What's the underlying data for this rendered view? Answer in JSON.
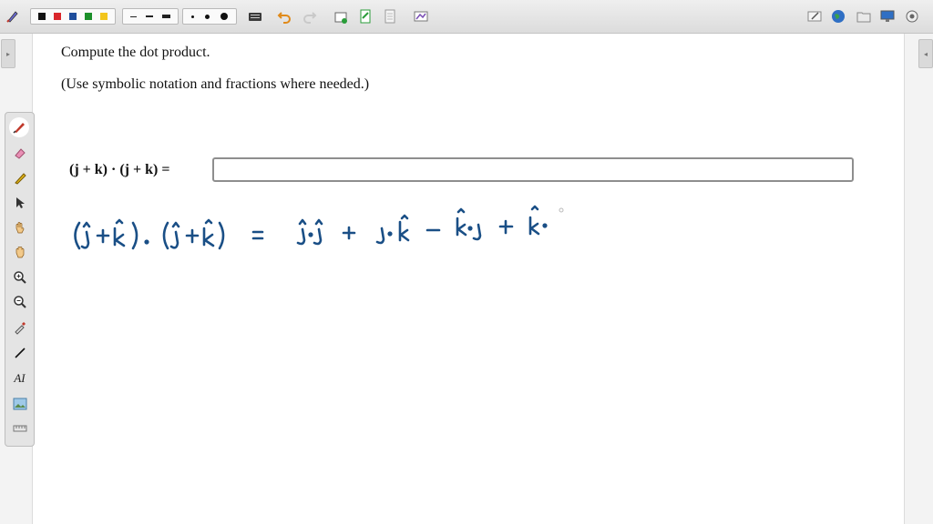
{
  "toolbar": {
    "left_tool": "pen-tool-icon",
    "colors": [
      "#111111",
      "#d9262b",
      "#1f4e9c",
      "#1c8f2a",
      "#f2c51c"
    ],
    "line_styles": [
      "thin-dash",
      "medium-dash",
      "thick-dash"
    ],
    "dot_sizes": [
      "small",
      "medium",
      "large"
    ],
    "actions": [
      "keyboard-icon",
      "undo-icon",
      "redo-icon",
      "new-page-icon",
      "add-page-icon",
      "page-icon",
      "screen-capture-icon"
    ],
    "right_actions": [
      "edit-icon",
      "globe-icon",
      "folder-icon",
      "display-icon",
      "settings-icon"
    ]
  },
  "problem": {
    "prompt": "Compute the dot product.",
    "instruction": "(Use symbolic notation and fractions where needed.)",
    "expression": "(j + k) · (j + k) =",
    "answer_value": ""
  },
  "handwriting": {
    "lhs": "(ĵ+k̂).(ĵ+k̂)",
    "equals": "=",
    "terms": [
      "ĵ.ĵ",
      "+",
      "j.k̂",
      "+",
      "k̂.j",
      "+",
      "k̂."
    ],
    "ink_color": "#1a4f86"
  },
  "palette": {
    "tools": [
      "pen-icon",
      "eraser-icon",
      "highlighter-icon",
      "pointer-icon",
      "hand-select-icon",
      "hand-pan-icon",
      "zoom-in-icon",
      "zoom-out-icon",
      "eyedropper-icon",
      "line-icon",
      "text-icon",
      "image-icon",
      "ruler-icon"
    ],
    "text_tool_label": "AI"
  }
}
